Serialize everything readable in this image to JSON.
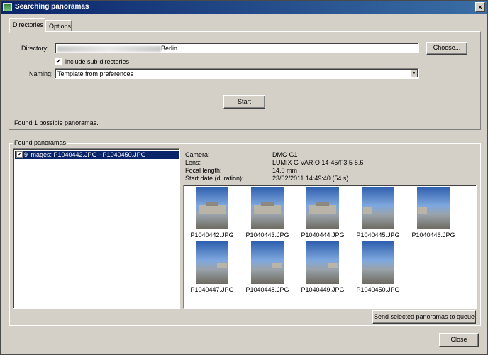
{
  "window": {
    "title": "Searching panoramas",
    "close_glyph": "×"
  },
  "tabs": [
    {
      "label": "Directories"
    },
    {
      "label": "Options"
    }
  ],
  "directory": {
    "label": "Directory:",
    "value_suffix": "Berlin",
    "browse_label": "Choose..."
  },
  "subdirs": {
    "label": "include sub-directories",
    "checked": true
  },
  "naming": {
    "label": "Naming:",
    "value": "Template from preferences"
  },
  "start_label": "Start",
  "status": "Found 1 possible panoramas.",
  "found": {
    "title": "Found panoramas",
    "items": [
      {
        "label": "9 images: P1040442.JPG - P1040450.JPG",
        "checked": true
      }
    ]
  },
  "details": {
    "camera_label": "Camera:",
    "camera_value": "DMC-G1",
    "lens_label": "Lens:",
    "lens_value": "LUMIX G VARIO 14-45/F3.5-5.6",
    "focal_label": "Focal length:",
    "focal_value": "14.0 mm",
    "start_label": "Start date (duration):",
    "start_value": "23/02/2011 14:49:40 (54 s)"
  },
  "thumbnails": [
    "P1040442.JPG",
    "P1040443.JPG",
    "P1040444.JPG",
    "P1040445.JPG",
    "P1040446.JPG",
    "P1040447.JPG",
    "P1040448.JPG",
    "P1040449.JPG",
    "P1040450.JPG"
  ],
  "send_label": "Send selected panoramas to queue",
  "close_label": "Close"
}
